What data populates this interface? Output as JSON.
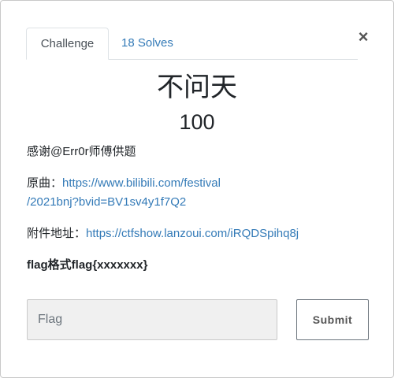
{
  "tabs": {
    "challenge_label": "Challenge",
    "solves_label": "18 Solves"
  },
  "close_glyph": "×",
  "challenge": {
    "name": "不问天",
    "value": "100",
    "thanks": "感谢@Err0r师傅供题",
    "source_label": "原曲：",
    "source_link_line1": "https://www.bilibili.com/festival",
    "source_link_line2": "/2021bnj?bvid=BV1sv4y1f7Q2",
    "attachment_label": "附件地址：",
    "attachment_link": "https://ctfshow.lanzoui.com/iRQDSpihq8j",
    "flag_format": "flag格式flag{xxxxxxx}"
  },
  "form": {
    "flag_placeholder": "Flag",
    "submit_label": "Submit"
  },
  "colors": {
    "link": "#337ab7",
    "text": "#212529",
    "input_bg": "#f0f0f0"
  },
  "icons": {
    "close": "close-icon"
  }
}
